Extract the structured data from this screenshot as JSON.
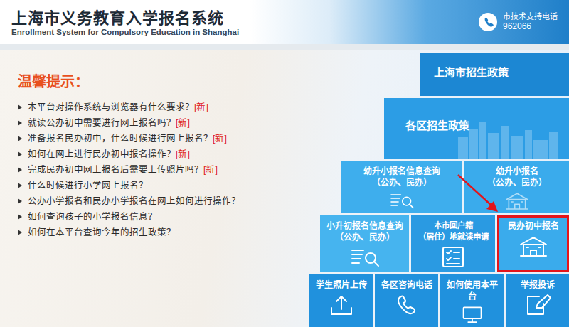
{
  "header": {
    "title": "上海市义务教育入学报名系统",
    "subtitle": "Enrollment System for Compulsory Education in Shanghai",
    "phone_label": "市技术支持电话",
    "phone_number": "962066"
  },
  "tips": {
    "title": "温馨提示：",
    "items": [
      {
        "text": "本平台对操作系统与浏览器有什么要求？",
        "tag": "[新]"
      },
      {
        "text": "就读公办初中需要进行网上报名吗？",
        "tag": "[新]"
      },
      {
        "text": "准备报名民办初中，什么时候进行网上报名？",
        "tag": "[新]"
      },
      {
        "text": "如何在网上进行民办初中报名操作？",
        "tag": "[新]"
      },
      {
        "text": "完成民办初中网上报名后需要上传照片吗？",
        "tag": "[新]"
      },
      {
        "text": "什么时候进行小学网上报名？"
      },
      {
        "text": "公办小学报名和民办小学报名在网上如何进行操作？"
      },
      {
        "text": "如何查询孩子的小学报名信息？"
      },
      {
        "text": "如何在本平台查询今年的招生政策？"
      }
    ]
  },
  "tiles": [
    {
      "lines": [
        "上海市招生政策"
      ],
      "highlighted": false
    },
    {
      "lines": [
        "各区招生政策"
      ],
      "highlighted": false
    },
    {
      "lines": [
        "幼升小报名信息查询",
        "（公办、民办）"
      ],
      "highlighted": false
    },
    {
      "lines": [
        "幼升小报名",
        "（公办、民办）"
      ],
      "highlighted": false
    },
    {
      "lines": [
        "小升初报名信息查询",
        "（公办、民办）"
      ],
      "highlighted": false
    },
    {
      "lines": [
        "本市回户籍",
        "（居住）地就读申请"
      ],
      "highlighted": false
    },
    {
      "lines": [
        "民办初中报名"
      ],
      "highlighted": true
    },
    {
      "lines": [
        "学生照片上传"
      ],
      "highlighted": false
    },
    {
      "lines": [
        "各区咨询电话"
      ],
      "highlighted": false
    },
    {
      "lines": [
        "如何使用本平台"
      ],
      "highlighted": false
    },
    {
      "lines": [
        "举报投诉"
      ],
      "highlighted": false
    }
  ]
}
